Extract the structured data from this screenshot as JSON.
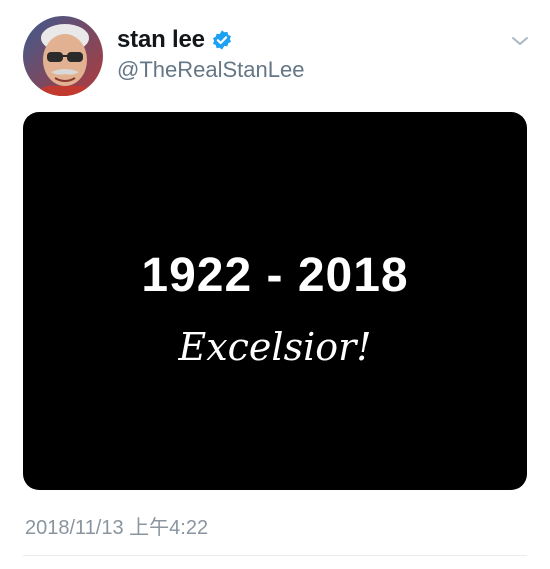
{
  "tweet": {
    "display_name": "stan lee",
    "handle": "@TheRealStanLee",
    "verified": true,
    "timestamp": "2018/11/13 上午4:22",
    "media": {
      "years": "1922 - 2018",
      "tagline": "Excelsior!"
    }
  },
  "icons": {
    "verified": "verified-badge-icon",
    "menu": "chevron-down-icon"
  },
  "colors": {
    "verified_blue": "#1da1f2",
    "name_text": "#14171a",
    "secondary_text": "#657786",
    "media_background": "#000000"
  }
}
